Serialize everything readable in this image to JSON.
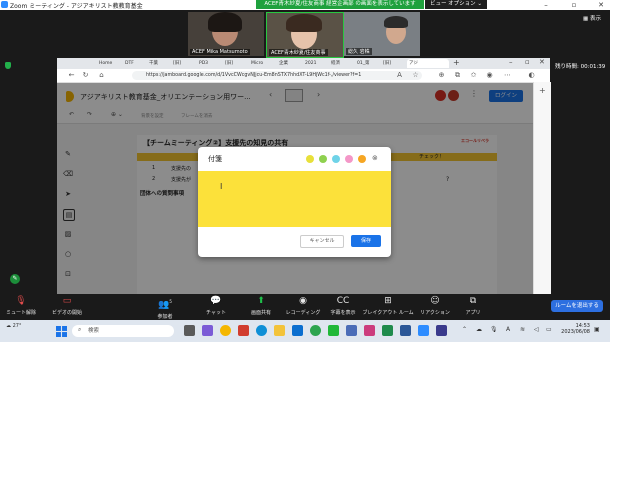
{
  "zoom": {
    "window_title": "Zoom ミーティング - アジアキリスト教教育基金",
    "share_banner": "ACEF青木紗夏/住友商事 経営企画部 の画面を表示しています",
    "view_option": "ビュー オプション ⌄",
    "view_button": "表示",
    "timer": "残り時間: 00:01:39",
    "participants": [
      {
        "name": "ACEF Mika Matsumoto"
      },
      {
        "name": "ACEF青木紗夏/住友商事"
      },
      {
        "name": "総久 岩株"
      }
    ],
    "controls": [
      {
        "label": "ミュート解除",
        "icon": "microphone-muted-icon"
      },
      {
        "label": "ビデオの開始",
        "icon": "video-off-icon"
      },
      {
        "label": "参加者",
        "icon": "participants-icon",
        "count": "5"
      },
      {
        "label": "チャット",
        "icon": "chat-icon"
      },
      {
        "label": "画面共有",
        "icon": "share-screen-icon"
      },
      {
        "label": "レコーディング",
        "icon": "record-icon"
      },
      {
        "label": "字幕を表示",
        "icon": "cc-icon"
      },
      {
        "label": "ブレイクアウト ルーム",
        "icon": "breakout-icon"
      },
      {
        "label": "リアクション",
        "icon": "reaction-icon"
      },
      {
        "label": "アプリ",
        "icon": "apps-icon"
      }
    ],
    "room_button": "ルームを退出する"
  },
  "browser": {
    "tabs": [
      "Home",
      "DTF",
      "千葉",
      "[旧]",
      "PD3",
      "[旧]",
      "Micro",
      "企業",
      "2021",
      "経済",
      "01_第",
      "[旧]",
      "アジ"
    ],
    "url": "https://jamboard.google.com/d/1VvcCWcgvNJjcu-Em8nSTX7hhdXT-L9HjWc1f-,/viewer?f=1"
  },
  "jamboard": {
    "title": "アジアキリスト教育基金_オリエンテーション用ワー...",
    "login": "ログイン",
    "toolbar": {
      "set_bg": "背景を設定",
      "clear_frame": "フレームを消去"
    },
    "board_title": "【チームミーティング②】支援先の知見の共有",
    "check_label": "チェック！",
    "logo_text": "エコールリベラ",
    "rows": [
      {
        "num": "1",
        "text": "支援先の"
      },
      {
        "num": "2",
        "text": "支援先が"
      }
    ],
    "section2": "団体への質問事項",
    "question_mark": "?"
  },
  "dialog": {
    "title": "付箋",
    "swatches": [
      "#e8e03a",
      "#8fd14f",
      "#6fd3e8",
      "#f497c8",
      "#f6a623"
    ],
    "cancel": "キャンセル",
    "save": "保存"
  },
  "taskbar": {
    "temperature": "27°",
    "search_placeholder": "検索",
    "time": "14:53",
    "date": "2023/06/08"
  }
}
